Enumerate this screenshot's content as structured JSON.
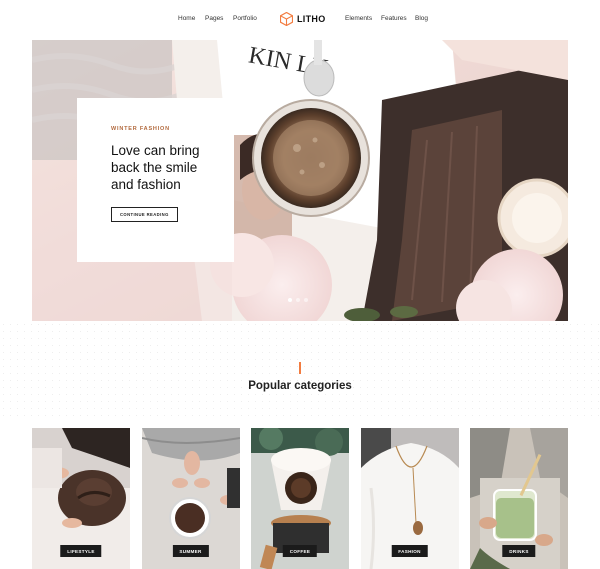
{
  "header": {
    "nav_left": [
      "Home",
      "Pages",
      "Portfolio"
    ],
    "brand": "LITHO",
    "nav_right": [
      "Elements",
      "Features",
      "Blog"
    ],
    "accent_color": "#f27c40"
  },
  "hero": {
    "eyebrow": "WINTER FASHION",
    "title": "Love can bring back the smile and fashion",
    "button_label": "CONTINUE READING",
    "slides": 3,
    "active_slide": 1
  },
  "categories": {
    "title": "Popular categories",
    "items": [
      {
        "label": "LIFESTYLE",
        "icon": "hat-photo"
      },
      {
        "label": "SUMMER",
        "icon": "coffee-cup-photo"
      },
      {
        "label": "COFFEE",
        "icon": "coffee-dripper-photo"
      },
      {
        "label": "FASHION",
        "icon": "necklace-photo"
      },
      {
        "label": "DRINKS",
        "icon": "matcha-drink-photo"
      }
    ]
  }
}
